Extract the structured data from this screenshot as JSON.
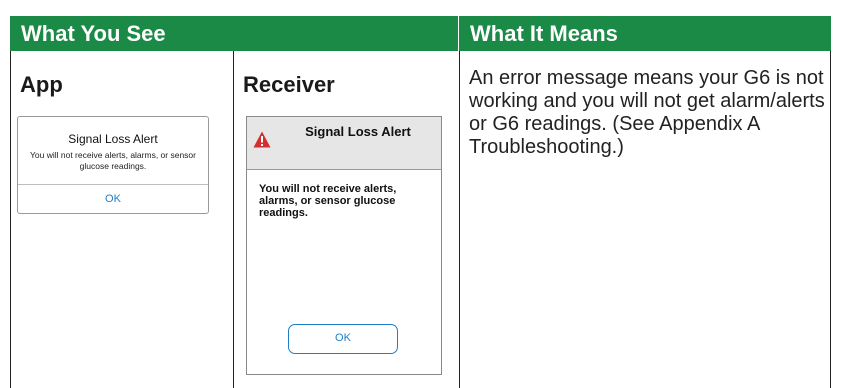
{
  "headers": {
    "what_you_see": "What You See",
    "what_it_means": "What It Means"
  },
  "columns": {
    "app": "App",
    "receiver": "Receiver"
  },
  "app_dialog": {
    "title": "Signal Loss Alert",
    "message": "You will not receive alerts, alarms, or sensor glucose readings.",
    "ok_label": "OK"
  },
  "receiver_dialog": {
    "title": "Signal Loss Alert",
    "message": "You will not receive alerts, alarms, or sensor glucose readings.",
    "ok_label": "OK",
    "icon": "warning-triangle-icon",
    "icon_color": "#d32f2f"
  },
  "meaning_text": "An error message means your G6 is not working and you will not get alarm/alerts or G6 readings. (See Appendix A Troubleshooting.)",
  "colors": {
    "header_green": "#1a8a46",
    "link_blue": "#1e7fc8"
  }
}
